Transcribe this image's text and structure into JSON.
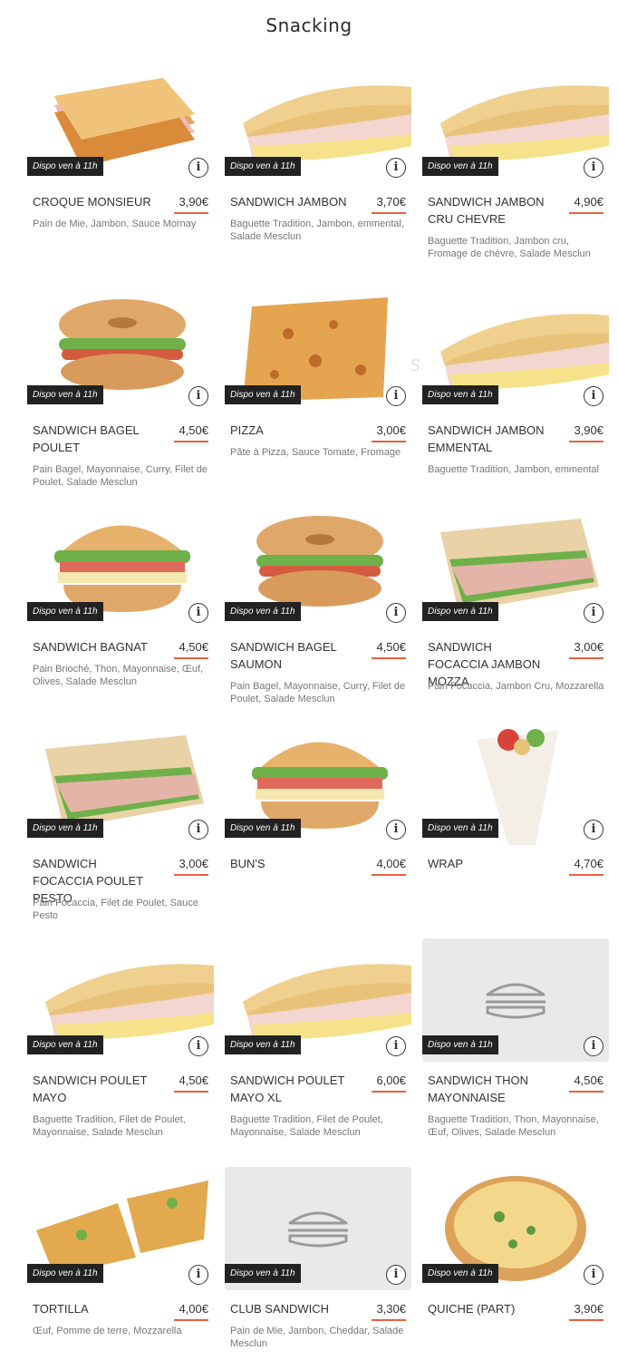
{
  "page": {
    "title": "Snacking",
    "watermark": "carte-list.fr"
  },
  "badge_label": "Dispo ven à 11h",
  "info_label": "i",
  "colors": {
    "accent": "#e8613c",
    "badge_bg": "#222222",
    "placeholder_bg": "#e9e9e9"
  },
  "products": [
    {
      "name": "CROQUE MONSIEUR",
      "price": "3,90€",
      "desc": "Pain de Mie, Jambon, Sauce Mornay",
      "image": "croque-image"
    },
    {
      "name": "SANDWICH JAMBON",
      "price": "3,70€",
      "desc": "Baguette Tradition, Jambon, emmental, Salade Mesclun",
      "image": "baguette-image"
    },
    {
      "name": "SANDWICH JAMBON CRU CHEVRE",
      "price": "4,90€",
      "desc": "Baguette Tradition, Jambon cru, Fromage de chèvre, Salade Mesclun",
      "image": "baguette-image"
    },
    {
      "name": "SANDWICH BAGEL POULET",
      "price": "4,50€",
      "desc": "Pain Bagel, Mayonnaise, Curry, Filet de Poulet, Salade Mesclun",
      "image": "bagel-image"
    },
    {
      "name": "PIZZA",
      "price": "3,00€",
      "desc": "Pâte à Pizza, Sauce Tomate, Fromage",
      "image": "pizza-image"
    },
    {
      "name": "SANDWICH JAMBON EMMENTAL",
      "price": "3,90€",
      "desc": "Baguette Tradition, Jambon, emmental",
      "image": "baguette-image"
    },
    {
      "name": "SANDWICH BAGNAT",
      "price": "4,50€",
      "desc": "Pain Brioché, Thon, Mayonnaise, Œuf, Olives, Salade Mesclun",
      "image": "burger-image"
    },
    {
      "name": "SANDWICH BAGEL SAUMON",
      "price": "4,50€",
      "desc": "Pain Bagel, Mayonnaise, Curry, Filet de Poulet, Salade Mesclun",
      "image": "bagel-image"
    },
    {
      "name": "SANDWICH FOCACCIA JAMBON MOZZA",
      "price": "3,00€",
      "desc": "Pain Focaccia, Jambon Cru, Mozzarella",
      "image": "focaccia-image"
    },
    {
      "name": "SANDWICH FOCACCIA POULET PESTO",
      "price": "3,00€",
      "desc": "Pain Focaccia, Filet de Poulet, Sauce Pesto",
      "image": "focaccia-image"
    },
    {
      "name": "BUN'S",
      "price": "4,00€",
      "desc": "",
      "image": "burger-image"
    },
    {
      "name": "WRAP",
      "price": "4,70€",
      "desc": "",
      "image": "wrap-image"
    },
    {
      "name": "SANDWICH POULET MAYO",
      "price": "4,50€",
      "desc": "Baguette Tradition, Filet de Poulet, Mayonnaise, Salade Mesclun",
      "image": "baguette-image"
    },
    {
      "name": "SANDWICH POULET MAYO XL",
      "price": "6,00€",
      "desc": "Baguette Tradition, Filet de Poulet, Mayonnaise, Salade Mesclun",
      "image": "baguette-image"
    },
    {
      "name": "SANDWICH THON MAYONNAISE",
      "price": "4,50€",
      "desc": "Baguette Tradition, Thon, Mayonnaise, Œuf, Olives, Salade Mesclun",
      "image": "sandwich-placeholder-icon"
    },
    {
      "name": "TORTILLA",
      "price": "4,00€",
      "desc": "Œuf, Pomme de terre, Mozzarella",
      "image": "tortilla-image"
    },
    {
      "name": "CLUB SANDWICH",
      "price": "3,30€",
      "desc": "Pain de Mie, Jambon, Cheddar, Salade Mesclun",
      "image": "sandwich-placeholder-icon"
    },
    {
      "name": "QUICHE (PART)",
      "price": "3,90€",
      "desc": "",
      "image": "quiche-image"
    }
  ]
}
